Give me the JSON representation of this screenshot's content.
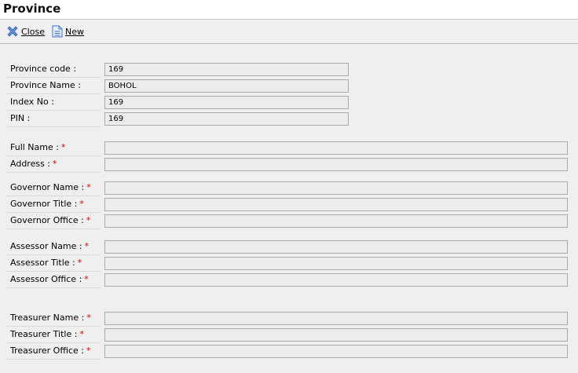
{
  "window": {
    "title": "Province"
  },
  "toolbar": {
    "close_label": "Close",
    "new_label": "New"
  },
  "form": {
    "province_code": {
      "label": "Province code :",
      "value": "169"
    },
    "province_name": {
      "label": "Province Name :",
      "value": "BOHOL"
    },
    "index_no": {
      "label": "Index No :",
      "value": "169"
    },
    "pin": {
      "label": "PIN :",
      "value": "169"
    },
    "full_name": {
      "label": "Full Name :",
      "value": ""
    },
    "address": {
      "label": "Address :",
      "value": ""
    },
    "governor_name": {
      "label": "Governor Name :",
      "value": ""
    },
    "governor_title": {
      "label": "Governor Title :",
      "value": ""
    },
    "governor_office": {
      "label": "Governor Office :",
      "value": ""
    },
    "assessor_name": {
      "label": "Assessor Name :",
      "value": ""
    },
    "assessor_title": {
      "label": "Assessor Title :",
      "value": ""
    },
    "assessor_office": {
      "label": "Assessor Office :",
      "value": ""
    },
    "treasurer_name": {
      "label": "Treasurer Name :",
      "value": ""
    },
    "treasurer_title": {
      "label": "Treasurer Title :",
      "value": ""
    },
    "treasurer_office": {
      "label": "Treasurer Office :",
      "value": ""
    },
    "required_marker": "*"
  }
}
